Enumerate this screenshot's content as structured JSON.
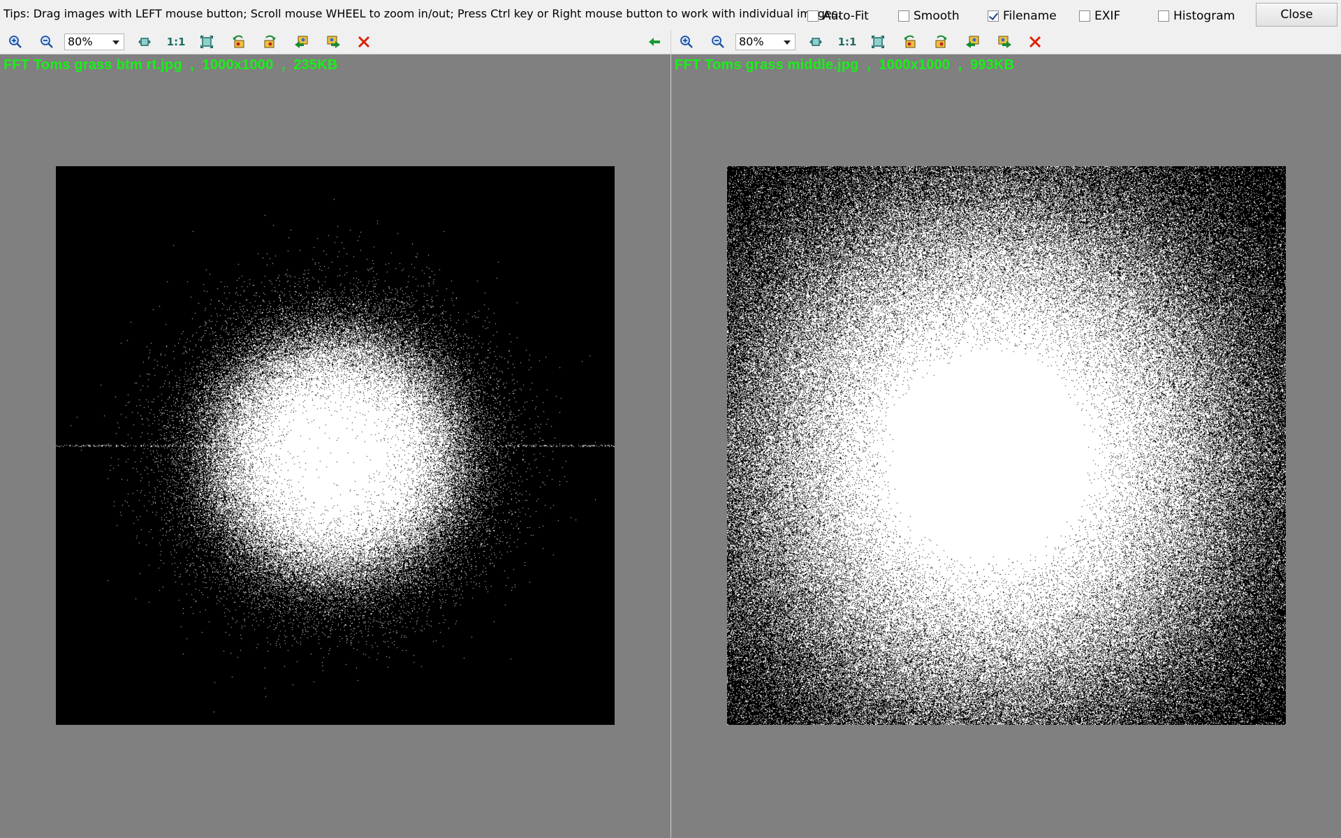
{
  "tips": "Tips: Drag images with LEFT mouse button; Scroll mouse WHEEL to zoom in/out; Press Ctrl key or Right mouse button to work with individual images.",
  "options": [
    {
      "label": "Auto-Fit",
      "checked": false
    },
    {
      "label": "Smooth",
      "checked": false
    },
    {
      "label": "Filename",
      "checked": true
    },
    {
      "label": "EXIF",
      "checked": false
    },
    {
      "label": "Histogram",
      "checked": false
    }
  ],
  "close_label": "Close",
  "panels": [
    {
      "zoom": "80%",
      "one_to_one": "1:1",
      "file_label": "FFT Toms grass btm rt.jpg  ,  1000x1000  ,  235KB",
      "spectrum": "concentrated"
    },
    {
      "zoom": "80%",
      "one_to_one": "1:1",
      "file_label": "FFT Toms grass middle.jpg  ,  1000x1000  ,  993KB",
      "spectrum": "wide"
    }
  ],
  "icons": [
    "zoom-in-icon",
    "zoom-out-icon",
    "fit-width-icon",
    "fit-window-icon",
    "rotate-left-icon",
    "rotate-right-icon",
    "previous-image-icon",
    "next-image-icon",
    "close-image-icon",
    "sync-left-arrow-icon"
  ],
  "colors": {
    "label_green": "#18f018",
    "viewer_gray": "#808080",
    "close_red": "#e02000"
  }
}
